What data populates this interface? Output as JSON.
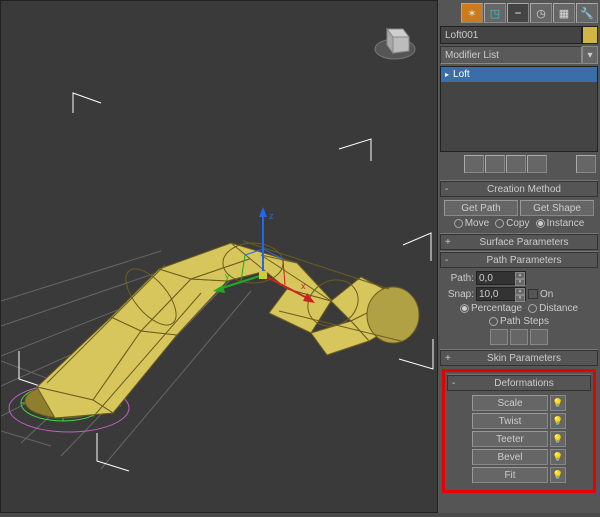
{
  "toolbar_icons": [
    "sphere",
    "arc",
    "box",
    "globe",
    "gear",
    "hammer"
  ],
  "object_name": "Loft001",
  "modifier_dropdown": "Modifier List",
  "stack": {
    "item": "Loft"
  },
  "rollouts": {
    "creation": {
      "title": "Creation Method",
      "get_path": "Get Path",
      "get_shape": "Get Shape",
      "move": "Move",
      "copy": "Copy",
      "instance": "Instance"
    },
    "surface": {
      "title": "Surface Parameters"
    },
    "path": {
      "title": "Path Parameters",
      "path_label": "Path:",
      "path_val": "0,0",
      "snap_label": "Snap:",
      "snap_val": "10,0",
      "on": "On",
      "percentage": "Percentage",
      "distance": "Distance",
      "path_steps": "Path Steps"
    },
    "skin": {
      "title": "Skin Parameters"
    },
    "deform": {
      "title": "Deformations",
      "scale": "Scale",
      "twist": "Twist",
      "teeter": "Teeter",
      "bevel": "Bevel",
      "fit": "Fit"
    }
  },
  "gizmo": {
    "x": "x",
    "y": "y",
    "z": "z"
  }
}
